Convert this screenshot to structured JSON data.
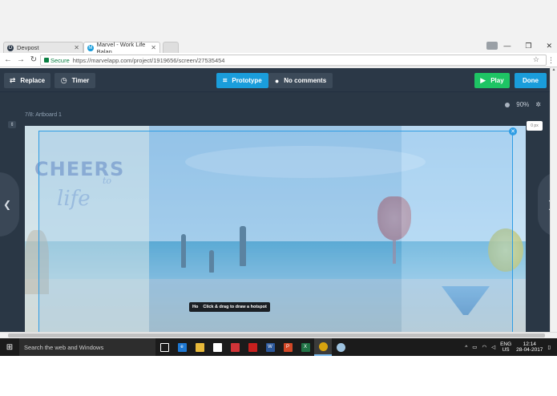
{
  "browser": {
    "tabs": [
      {
        "label": "Devpost",
        "favicon": "D",
        "active": false
      },
      {
        "label": "Marvel - Work Life Balan",
        "favicon": "M",
        "active": true
      }
    ],
    "secure_label": "Secure",
    "url": "https://marvelapp.com/project/1919656/screen/27535454"
  },
  "toolbar": {
    "replace_label": "Replace",
    "timer_label": "Timer",
    "prototype_label": "Prototype",
    "comments_label": "No comments",
    "play_label": "Play",
    "done_label": "Done"
  },
  "canvas": {
    "zoom": "90%",
    "artboard_label": "7/8: Artboard 1",
    "px_badge": "0 px",
    "artwork_text_1": "CHEERS",
    "artwork_text_2": "to",
    "artwork_text_3": "life",
    "tooltip_prefix": "Ho",
    "tooltip_text": "Click & drag to draw a hotspot"
  },
  "taskbar": {
    "search_placeholder": "Search the web and Windows",
    "language_1": "ENG",
    "language_2": "US",
    "time": "12:14",
    "date": "28-04-2017"
  },
  "colors": {
    "app_bg": "#2a3745",
    "prototype_blue": "#1a9ddb",
    "play_green": "#1ec464",
    "hotspot_blue": "#2f9de4"
  }
}
